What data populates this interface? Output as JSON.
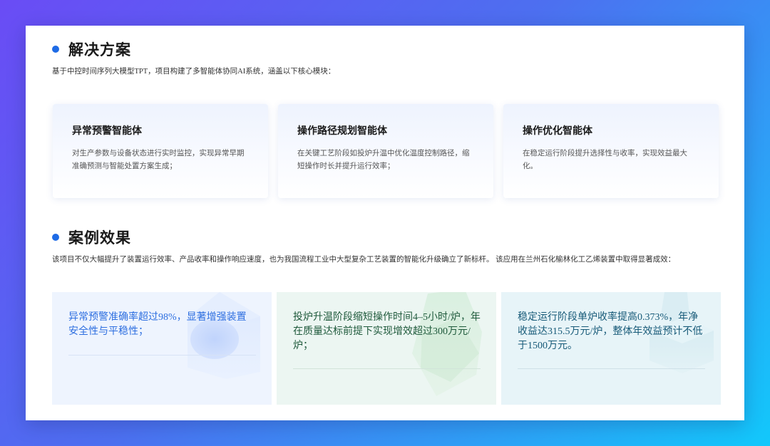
{
  "solution": {
    "title": "解决方案",
    "description": "基于中控时间序列大模型TPT，项目构建了多智能体协同AI系统，涵盖以下核心模块：",
    "modules": [
      {
        "title": "异常预警智能体",
        "desc": "对生产参数与设备状态进行实时监控，实现异常早期准确预测与智能处置方案生成；"
      },
      {
        "title": "操作路径规划智能体",
        "desc": "在关键工艺阶段如投炉升温中优化温度控制路径，缩短操作时长并提升运行效率；"
      },
      {
        "title": "操作优化智能体",
        "desc": "在稳定运行阶段提升选择性与收率，实现效益最大化。"
      }
    ]
  },
  "cases": {
    "title": "案例效果",
    "description": "该项目不仅大幅提升了装置运行效率、产品收率和操作响应速度，也为我国流程工业中大型复杂工艺装置的智能化升级确立了新标杆。 该应用在兰州石化榆林化工乙烯装置中取得显著成效：",
    "results": [
      {
        "text": "异常预警准确率超过98%，显著增强装置安全性与平稳性；"
      },
      {
        "text": "投炉升温阶段缩短操作时间4–5小时/炉，年在质量达标前提下实现增效超过300万元/炉；"
      },
      {
        "text": "稳定运行阶段单炉收率提高0.373%，年净收益达315.5万元/炉，整体年效益预计不低于1500万元。"
      }
    ]
  },
  "colors": {
    "accent": "#1e6be6",
    "result1_text": "#2e6fe0",
    "result2_text": "#1f5a3c",
    "result3_text": "#175a78"
  }
}
